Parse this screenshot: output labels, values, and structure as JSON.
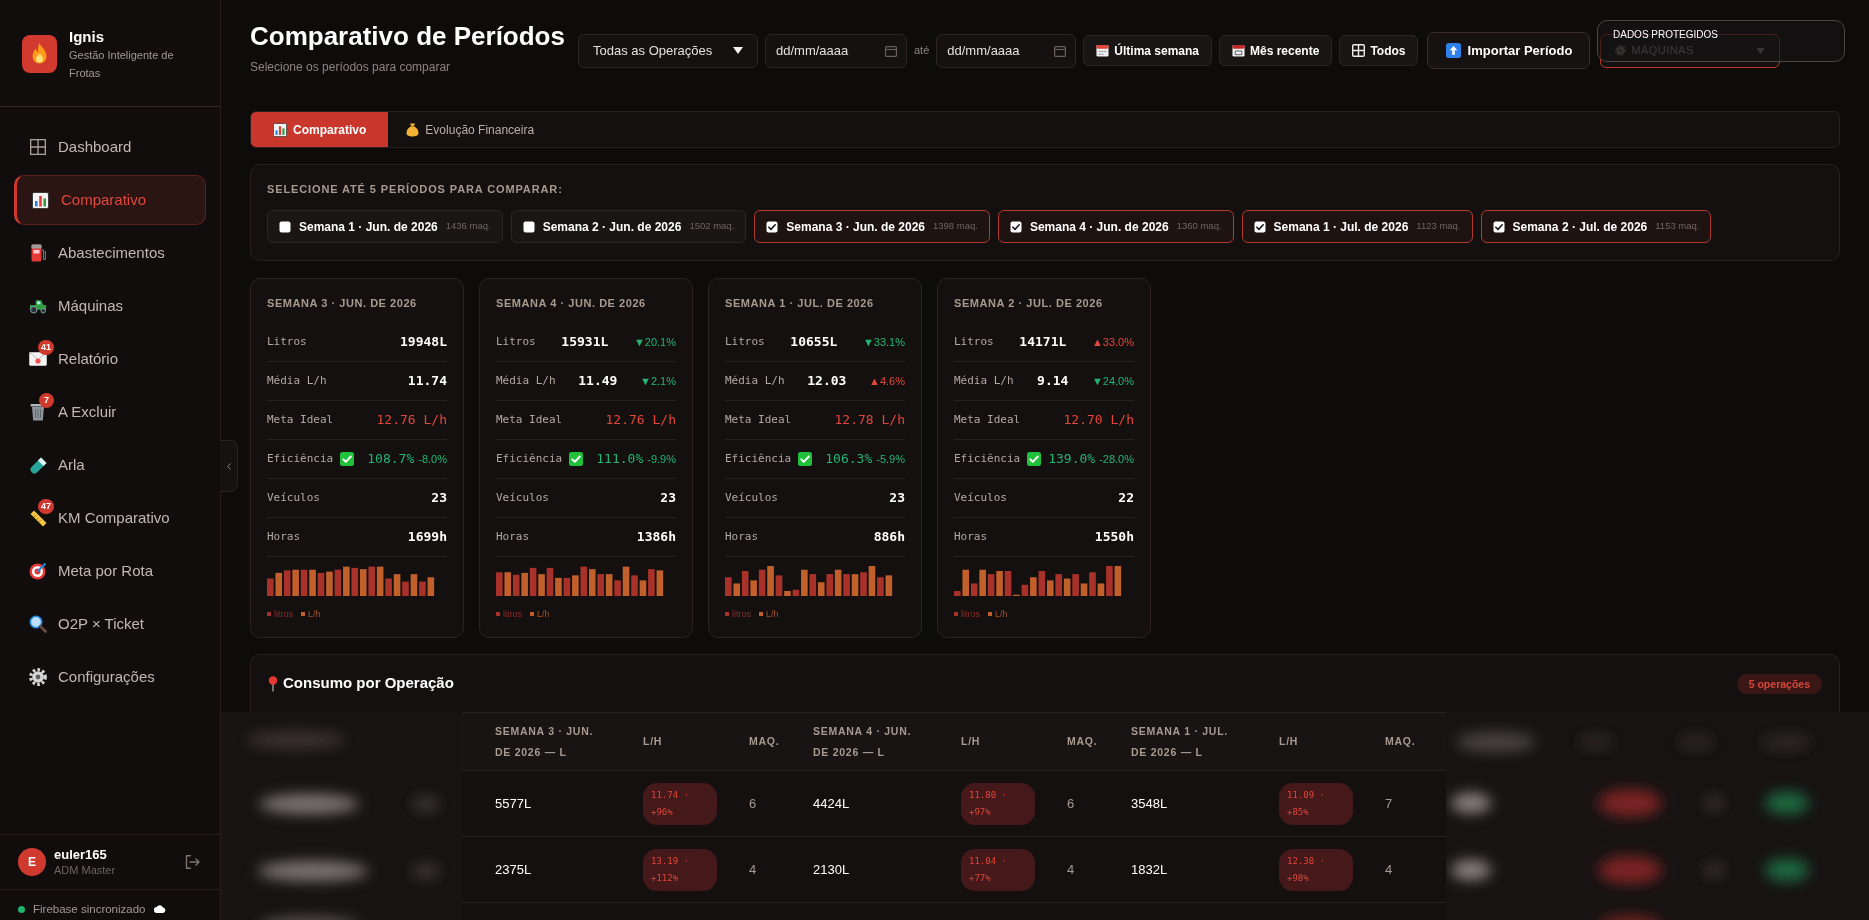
{
  "sidebar": {
    "brand": {
      "name": "Ignis",
      "tagline": "Gestão Inteligente de Frotas"
    },
    "nav": [
      {
        "label": "Dashboard",
        "selected": false
      },
      {
        "label": "Comparativo",
        "selected": true
      },
      {
        "label": "Abastecimentos",
        "selected": false
      },
      {
        "label": "Máquinas",
        "selected": false
      },
      {
        "label": "Relatório",
        "selected": false,
        "badge": "41"
      },
      {
        "label": "A Excluir",
        "selected": false,
        "badge": "7"
      },
      {
        "label": "Arla",
        "selected": false
      },
      {
        "label": "KM Comparativo",
        "selected": false,
        "badge": "47"
      },
      {
        "label": "Meta por Rota",
        "selected": false
      },
      {
        "label": "O2P × Ticket",
        "selected": false
      },
      {
        "label": "Configurações",
        "selected": false
      }
    ],
    "user": {
      "initial": "E",
      "name": "euler165",
      "role": "ADM Master"
    },
    "sync_status": {
      "text": "Firebase sincronizado",
      "online": true
    }
  },
  "header": {
    "title": "Comparativo de Períodos",
    "subtitle": "Selecione os períodos para comparar",
    "operation_select": {
      "value": "Todas as Operações"
    },
    "date_from": {
      "placeholder": "dd/mm/aaaa"
    },
    "range_separator": "até",
    "date_to": {
      "placeholder": "dd/mm/aaaa"
    },
    "quick_buttons": [
      {
        "label": "Última semana"
      },
      {
        "label": "Mês recente"
      },
      {
        "label": "Todos"
      }
    ],
    "import_button": {
      "label": "Importar Período"
    },
    "machines_select": {
      "value": "MÁQUINAS"
    },
    "protected_notice": {
      "text": "DADOS PROTEGIDOS"
    }
  },
  "tabs": [
    {
      "label": "Comparativo",
      "selected": true
    },
    {
      "label": "Evolução Financeira",
      "selected": false
    }
  ],
  "period_selector": {
    "label": "SELECIONE ATÉ 5 PERÍODOS PARA COMPARAR:",
    "periods": [
      {
        "label": "Semana 1 · Jun. de 2026",
        "count": "1436 maq.",
        "checked": false
      },
      {
        "label": "Semana 2 · Jun. de 2026",
        "count": "1502 maq.",
        "checked": false
      },
      {
        "label": "Semana 3 · Jun. de 2026",
        "count": "1398 maq.",
        "checked": true
      },
      {
        "label": "Semana 4 · Jun. de 2026",
        "count": "1360 maq.",
        "checked": true
      },
      {
        "label": "Semana 1 · Jul. de 2026",
        "count": "1123 maq.",
        "checked": true
      },
      {
        "label": "Semana 2 · Jul. de 2026",
        "count": "1153 maq.",
        "checked": true
      }
    ]
  },
  "period_cards": [
    {
      "title": "SEMANA 3 · JUN. DE 2026",
      "rows": [
        {
          "kind": "metric",
          "label": "Litros",
          "value": "19948L"
        },
        {
          "kind": "metric",
          "label": "Média L/h",
          "value": "11.74"
        },
        {
          "kind": "target",
          "label": "Meta Ideal",
          "value": "12.76 L/h"
        },
        {
          "kind": "efficiency",
          "label": "Eficiência",
          "ok": true,
          "value": "108.7%",
          "delta": "-8.0%",
          "favorable": true
        },
        {
          "kind": "metric",
          "label": "Veículos",
          "value": "23"
        },
        {
          "kind": "metric",
          "label": "Horas",
          "value": "1699h"
        }
      ],
      "legend": [
        {
          "label": "litros",
          "color": "#a8322a"
        },
        {
          "label": "L/h",
          "color": "#c2602c"
        }
      ]
    },
    {
      "title": "SEMANA 4 · JUN. DE 2026",
      "rows": [
        {
          "kind": "metric",
          "label": "Litros",
          "value": "15931L",
          "delta": "▼20.1%",
          "favorable": true
        },
        {
          "kind": "metric",
          "label": "Média L/h",
          "value": "11.49",
          "delta": "▼2.1%",
          "favorable": true
        },
        {
          "kind": "target",
          "label": "Meta Ideal",
          "value": "12.76 L/h"
        },
        {
          "kind": "efficiency",
          "label": "Eficiência",
          "ok": true,
          "value": "111.0%",
          "delta": "-9.9%",
          "favorable": true
        },
        {
          "kind": "metric",
          "label": "Veículos",
          "value": "23"
        },
        {
          "kind": "metric",
          "label": "Horas",
          "value": "1386h"
        }
      ],
      "legend": [
        {
          "label": "litros",
          "color": "#a8322a"
        },
        {
          "label": "L/h",
          "color": "#c2602c"
        }
      ]
    },
    {
      "title": "SEMANA 1 · JUL. DE 2026",
      "rows": [
        {
          "kind": "metric",
          "label": "Litros",
          "value": "10655L",
          "delta": "▼33.1%",
          "favorable": true
        },
        {
          "kind": "metric",
          "label": "Média L/h",
          "value": "12.03",
          "delta": "▲4.6%",
          "favorable": false
        },
        {
          "kind": "target",
          "label": "Meta Ideal",
          "value": "12.78 L/h"
        },
        {
          "kind": "efficiency",
          "label": "Eficiência",
          "ok": true,
          "value": "106.3%",
          "delta": "-5.9%",
          "favorable": true
        },
        {
          "kind": "metric",
          "label": "Veículos",
          "value": "23"
        },
        {
          "kind": "metric",
          "label": "Horas",
          "value": "886h"
        }
      ],
      "legend": [
        {
          "label": "litros",
          "color": "#a8322a"
        },
        {
          "label": "L/h",
          "color": "#c2602c"
        }
      ]
    },
    {
      "title": "SEMANA 2 · JUL. DE 2026",
      "rows": [
        {
          "kind": "metric",
          "label": "Litros",
          "value": "14171L",
          "delta": "▲33.0%",
          "favorable": false
        },
        {
          "kind": "metric",
          "label": "Média L/h",
          "value": "9.14",
          "delta": "▼24.0%",
          "favorable": true
        },
        {
          "kind": "target",
          "label": "Meta Ideal",
          "value": "12.70 L/h"
        },
        {
          "kind": "efficiency",
          "label": "Eficiência",
          "ok": true,
          "value": "139.0%",
          "delta": "-28.0%",
          "favorable": true
        },
        {
          "kind": "metric",
          "label": "Veículos",
          "value": "22"
        },
        {
          "kind": "metric",
          "label": "Horas",
          "value": "1550h"
        }
      ],
      "legend": [
        {
          "label": "litros",
          "color": "#a8322a"
        },
        {
          "label": "L/h",
          "color": "#c2602c"
        }
      ]
    }
  ],
  "operations_table": {
    "title": "Consumo por Operação",
    "count_badge": "5 operações",
    "columns": [
      {
        "label": "SEMANA 3 · JUN. DE 2026 — L"
      },
      {
        "label": "L/H"
      },
      {
        "label": "MAQ."
      },
      {
        "label": "SEMANA 4 · JUN. DE 2026 — L"
      },
      {
        "label": "L/H"
      },
      {
        "label": "MAQ."
      },
      {
        "label": "SEMANA 1 · JUL. DE 2026 — L"
      },
      {
        "label": "L/H"
      },
      {
        "label": "MAQ."
      }
    ],
    "rows": [
      {
        "cells": [
          {
            "kind": "liters",
            "text": "5577L"
          },
          {
            "kind": "rate",
            "text": "11.74 · +96%"
          },
          {
            "kind": "count",
            "text": "6"
          },
          {
            "kind": "liters",
            "text": "4424L"
          },
          {
            "kind": "rate",
            "text": "11.80 · +97%"
          },
          {
            "kind": "count",
            "text": "6"
          },
          {
            "kind": "liters",
            "text": "3548L"
          },
          {
            "kind": "rate",
            "text": "11.09 · +85%"
          },
          {
            "kind": "count",
            "text": "7"
          }
        ]
      },
      {
        "cells": [
          {
            "kind": "liters",
            "text": "2375L"
          },
          {
            "kind": "rate",
            "text": "13.19 · +112%"
          },
          {
            "kind": "count",
            "text": "4"
          },
          {
            "kind": "liters",
            "text": "2130L"
          },
          {
            "kind": "rate",
            "text": "11.04 · +77%"
          },
          {
            "kind": "count",
            "text": "4"
          },
          {
            "kind": "liters",
            "text": "1832L"
          },
          {
            "kind": "rate",
            "text": "12.30 · +98%"
          },
          {
            "kind": "count",
            "text": "4"
          }
        ]
      }
    ]
  }
}
